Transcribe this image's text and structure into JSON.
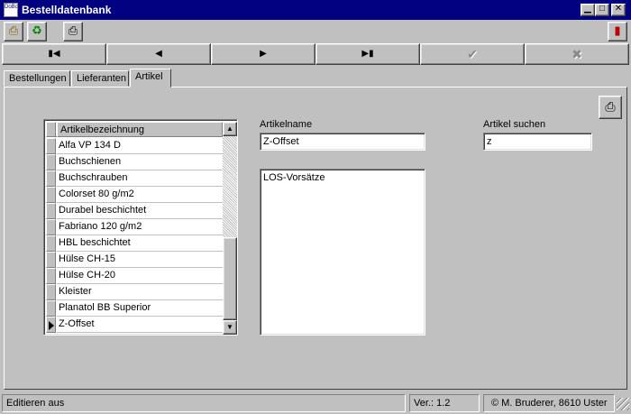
{
  "window": {
    "title": "Bestelldatenbank",
    "app_icon_text": "DoBone",
    "min_glyph": "▁",
    "max_glyph": "□",
    "close_glyph": "✕"
  },
  "toolbar": {
    "icons": [
      "document-icon",
      "sync-icon",
      "printer-icon",
      "exit-door-icon"
    ],
    "icon_glyphs": [
      "⎙",
      "♻",
      "⎙",
      "▮"
    ]
  },
  "navigator": {
    "first": "▮◀",
    "prev": "◀",
    "next": "▶",
    "last": "▶▮",
    "post": "✔",
    "cancel": "✖"
  },
  "tabs": [
    {
      "label": "Bestellungen"
    },
    {
      "label": "Lieferanten"
    },
    {
      "label": "Artikel"
    }
  ],
  "grid": {
    "header": "Artikelbezeichnung",
    "rows": [
      "Alfa VP 134 D",
      "Buchschienen",
      "Buchschrauben",
      "Colorset 80 g/m2",
      "Durabel beschichtet",
      "Fabriano 120 g/m2",
      "HBL beschichtet",
      "Hülse CH-15",
      "Hülse CH-20",
      "Kleister",
      "Planatol BB Superior",
      "Z-Offset"
    ],
    "selected_index": 11
  },
  "form": {
    "artikelname_label": "Artikelname",
    "artikelname_value": "Z-Offset",
    "memo_value": "LOS-Vorsätze",
    "search_label": "Artikel suchen",
    "search_value": "z"
  },
  "statusbar": {
    "status": "Editieren aus",
    "version": "Ver.: 1.2",
    "copyright": "© M. Bruderer, 8610 Uster"
  }
}
